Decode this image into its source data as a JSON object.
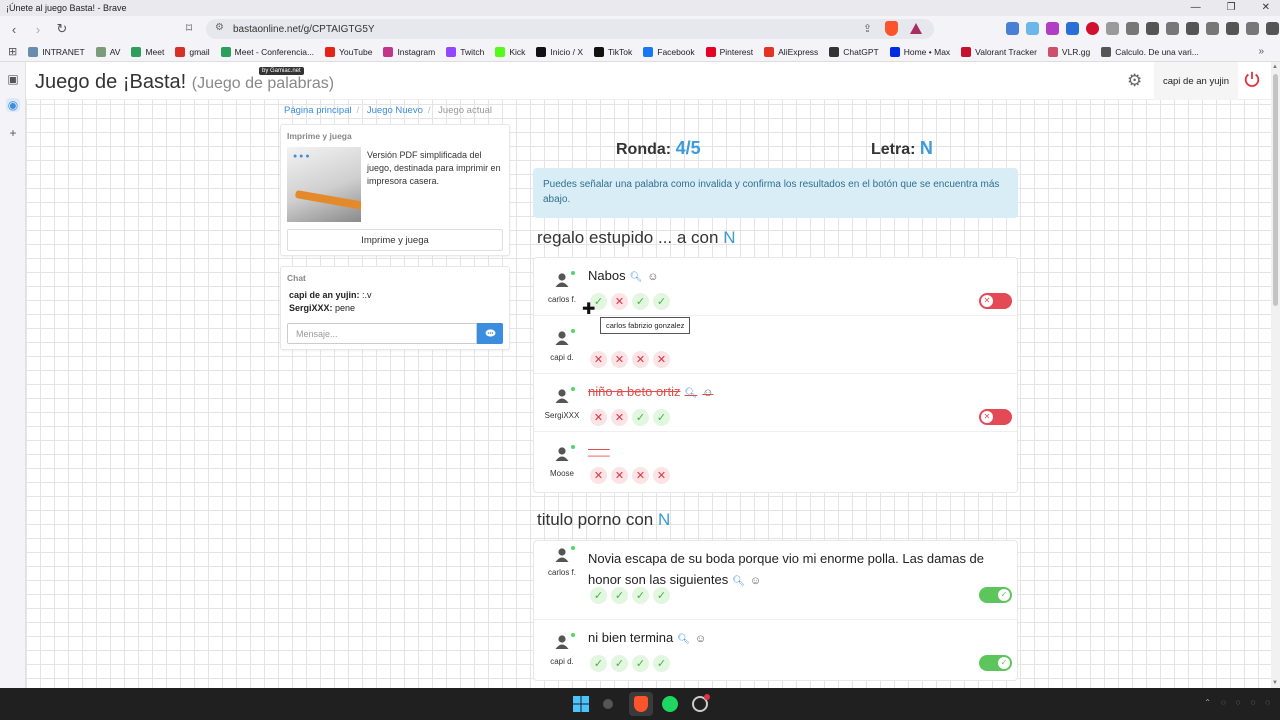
{
  "window": {
    "title": "¡Únete al juego Basta! - Brave"
  },
  "browser": {
    "url": "bastaonline.net/g/CPTAIGTG5Y",
    "bookmarks": [
      {
        "label": "INTRANET",
        "color": "#6a8caf"
      },
      {
        "label": "AV",
        "color": "#7a9c7a"
      },
      {
        "label": "Meet",
        "color": "#2e9e5b"
      },
      {
        "label": "gmail",
        "color": "#d93025"
      },
      {
        "label": "Meet - Conferencia...",
        "color": "#2e9e5b"
      },
      {
        "label": "YouTube",
        "color": "#e62117"
      },
      {
        "label": "Instagram",
        "color": "#c1358a"
      },
      {
        "label": "Twitch",
        "color": "#9146ff"
      },
      {
        "label": "Kick",
        "color": "#53fc18"
      },
      {
        "label": "Inicio / X",
        "color": "#111111"
      },
      {
        "label": "TikTok",
        "color": "#111111"
      },
      {
        "label": "Facebook",
        "color": "#1877f2"
      },
      {
        "label": "Pinterest",
        "color": "#e60023"
      },
      {
        "label": "AliExpress",
        "color": "#e43225"
      },
      {
        "label": "ChatGPT",
        "color": "#333333"
      },
      {
        "label": "Home • Max",
        "color": "#002be7"
      },
      {
        "label": "Valorant Tracker",
        "color": "#c8102e"
      },
      {
        "label": "VLR.gg",
        "color": "#d04e6d"
      },
      {
        "label": "Calculo. De una vari...",
        "color": "#555555"
      }
    ]
  },
  "site": {
    "title": "Juego de ¡Basta!",
    "subtitle": "(Juego de palabras)",
    "badge": "by Gamiac.net",
    "user": "capi de an yujin"
  },
  "breadcrumb": [
    "Página principal",
    "Juego Nuevo",
    "Juego actual"
  ],
  "print_panel": {
    "title": "Imprime y juega",
    "description": "Versión PDF simplificada del juego, destinada para imprimir en impresora casera.",
    "button": "Imprime y juega"
  },
  "chat": {
    "title": "Chat",
    "messages": [
      {
        "author": "capi de an yujin:",
        "text": ":.v"
      },
      {
        "author": "SergiXXX:",
        "text": "pene"
      }
    ],
    "placeholder": "Mensaje..."
  },
  "game": {
    "round_label": "Ronda:",
    "round_value": "4/5",
    "letter_label": "Letra:",
    "letter_value": "N",
    "notice": "Puedes señalar una palabra como invalida y confirma los resultados en el botón que se encuentra más abajo."
  },
  "categories": [
    {
      "title": "regalo estupido ... a con",
      "letter": "N",
      "rows": [
        {
          "player": "carlos f.",
          "answer": "Nabos",
          "invalid": false,
          "votes": [
            "yes",
            "no",
            "yes",
            "yes"
          ],
          "toggle": "off"
        },
        {
          "player": "capi d.",
          "answer": "",
          "invalid": false,
          "votes": [
            "no",
            "no",
            "no",
            "no"
          ],
          "toggle": null
        },
        {
          "player": "SergiXXX",
          "answer": "niño a beto ortiz",
          "invalid": true,
          "votes": [
            "no",
            "no",
            "yes",
            "yes"
          ],
          "toggle": "off"
        },
        {
          "player": "Moose",
          "answer": "___",
          "invalid": true,
          "votes": [
            "no",
            "no",
            "no",
            "no"
          ],
          "toggle": null
        }
      ]
    },
    {
      "title": "titulo porno con",
      "letter": "N",
      "rows": [
        {
          "player": "carlos f.",
          "answer": "Novia escapa de su boda porque vio mi enorme polla. Las damas de honor son las siguientes",
          "invalid": false,
          "votes": [
            "yes",
            "yes",
            "yes",
            "yes"
          ],
          "toggle": "on"
        },
        {
          "player": "capi d.",
          "answer": "ni bien termina",
          "invalid": false,
          "votes": [
            "yes",
            "yes",
            "yes",
            "yes"
          ],
          "toggle": "on"
        }
      ]
    }
  ],
  "tooltip": "carlos fabrizio gonzalez"
}
